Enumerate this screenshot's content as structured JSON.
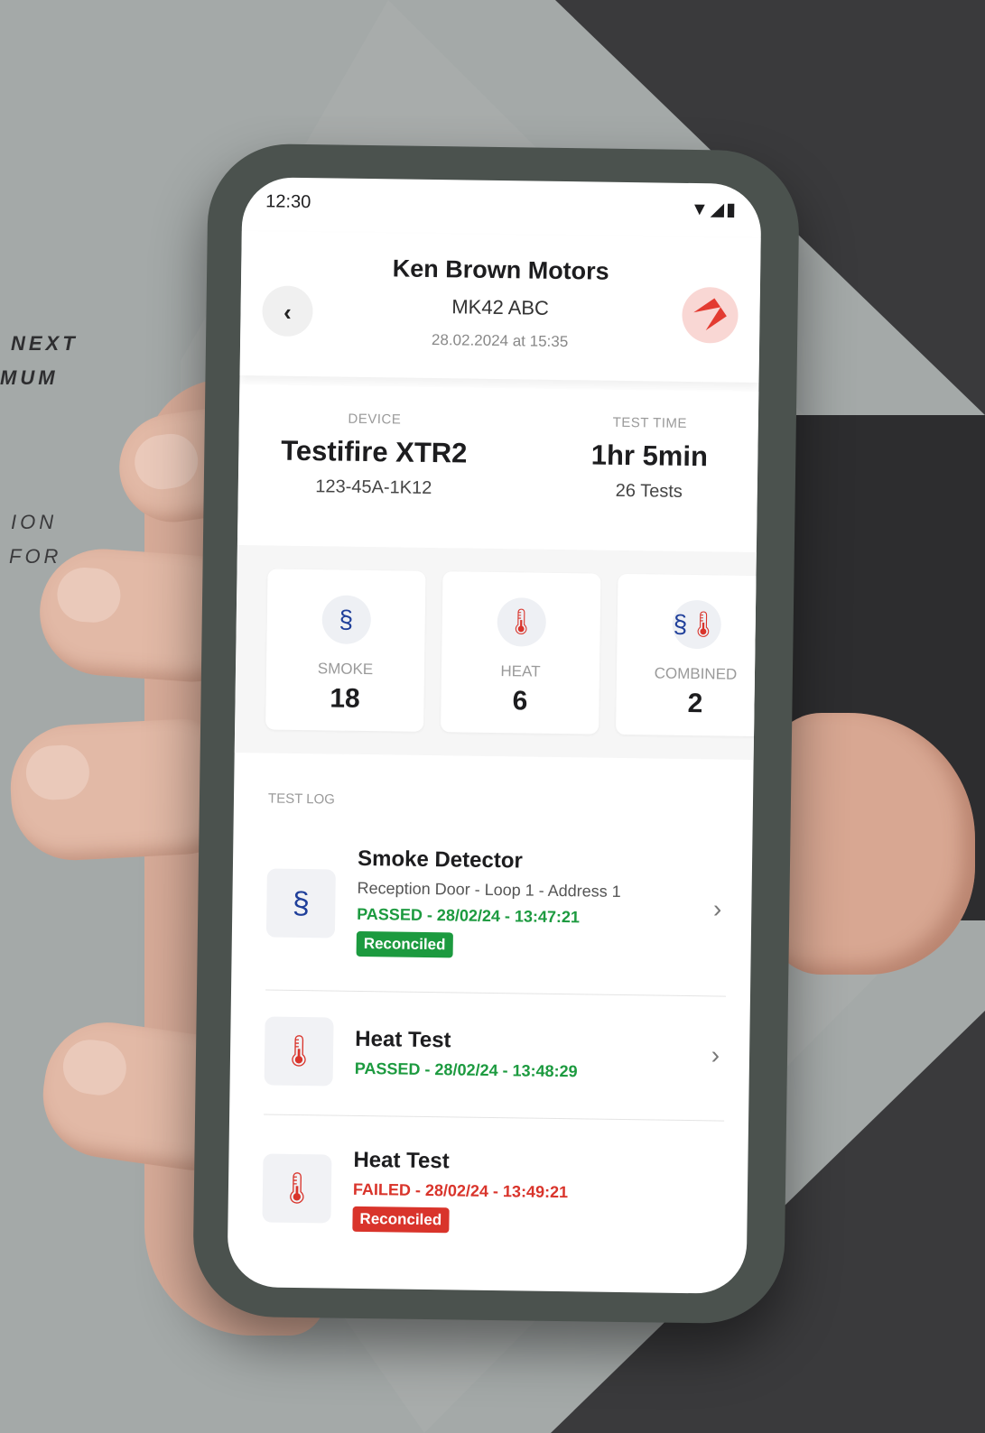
{
  "side_texts": [
    "NEXT",
    "MUM",
    "ION",
    "FOR"
  ],
  "status_bar": {
    "time": "12:30",
    "icons": "▼◢▮"
  },
  "header": {
    "title": "Ken Brown Motors",
    "subtitle": "MK42 ABC",
    "date": "28.02.2024 at 15:35",
    "back_label": "‹"
  },
  "info": {
    "device_label": "DEVICE",
    "device_name": "Testifire XTR2",
    "device_serial": "123-45A-1K12",
    "time_label": "TEST TIME",
    "time_value": "1hr 5min",
    "time_tests": "26 Tests"
  },
  "cards": [
    {
      "icon": "smoke-icon",
      "label": "SMOKE",
      "count": "18"
    },
    {
      "icon": "heat-icon",
      "label": "HEAT",
      "count": "6"
    },
    {
      "icon": "combined-icon",
      "label": "COMBINED",
      "count": "2"
    }
  ],
  "log": {
    "title": "TEST LOG",
    "items": [
      {
        "icon": "smoke-detector-icon",
        "name": "Smoke Detector",
        "location": "Reception Door  -  Loop 1 - Address 1",
        "status": "PASSED - 28/02/24 - 13:47:21",
        "badge": "Reconciled"
      },
      {
        "icon": "thermometer-icon",
        "name": "Heat Test",
        "status": "PASSED - 28/02/24 - 13:48:29"
      },
      {
        "icon": "thermometer-icon",
        "name": "Heat Test",
        "status": "FAILED - 28/02/24 - 13:49:21",
        "badge": "Reconciled"
      }
    ]
  },
  "colors": {
    "pass": "#1c9a3f",
    "fail": "#d9342b",
    "accent": "#e33b31"
  }
}
